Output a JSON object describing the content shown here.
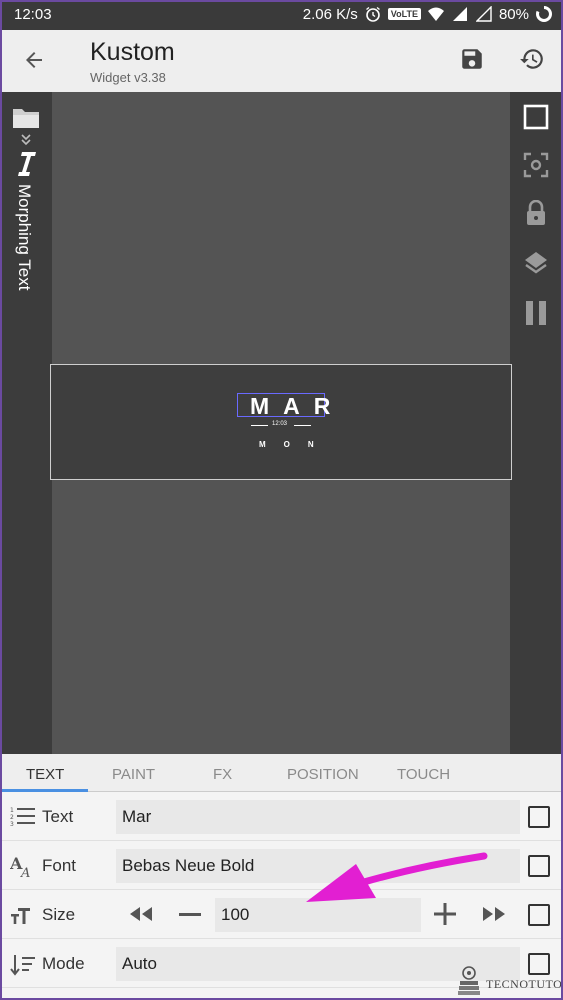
{
  "status_bar": {
    "time": "12:03",
    "net_speed": "2.06 K/s",
    "volte": "VoLTE",
    "battery": "80%"
  },
  "app_bar": {
    "title": "Kustom",
    "subtitle": "Widget v3.38"
  },
  "left_rail": {
    "label": "Morphing Text"
  },
  "widget_preview": {
    "month": "MAR",
    "time": "12:03",
    "day": "MON"
  },
  "tabs": [
    {
      "label": "TEXT",
      "active": true
    },
    {
      "label": "PAINT",
      "active": false
    },
    {
      "label": "FX",
      "active": false
    },
    {
      "label": "POSITION",
      "active": false
    },
    {
      "label": "TOUCH",
      "active": false
    }
  ],
  "properties": {
    "text": {
      "label": "Text",
      "value": "Mar",
      "checked": false
    },
    "font": {
      "label": "Font",
      "value": "Bebas Neue Bold",
      "checked": false
    },
    "size": {
      "label": "Size",
      "value": "100",
      "checked": false
    },
    "mode": {
      "label": "Mode",
      "value": "Auto",
      "checked": false
    }
  },
  "annotation": {
    "arrow_color": "#e21fd2"
  },
  "watermark": {
    "text": "TECNOTUTO"
  },
  "colors": {
    "status_bar": "#3a3a3a",
    "app_bar": "#eeeeee",
    "editor_dark": "#3c3c3c",
    "canvas": "#545454",
    "tab_accent": "#4a90e2"
  }
}
